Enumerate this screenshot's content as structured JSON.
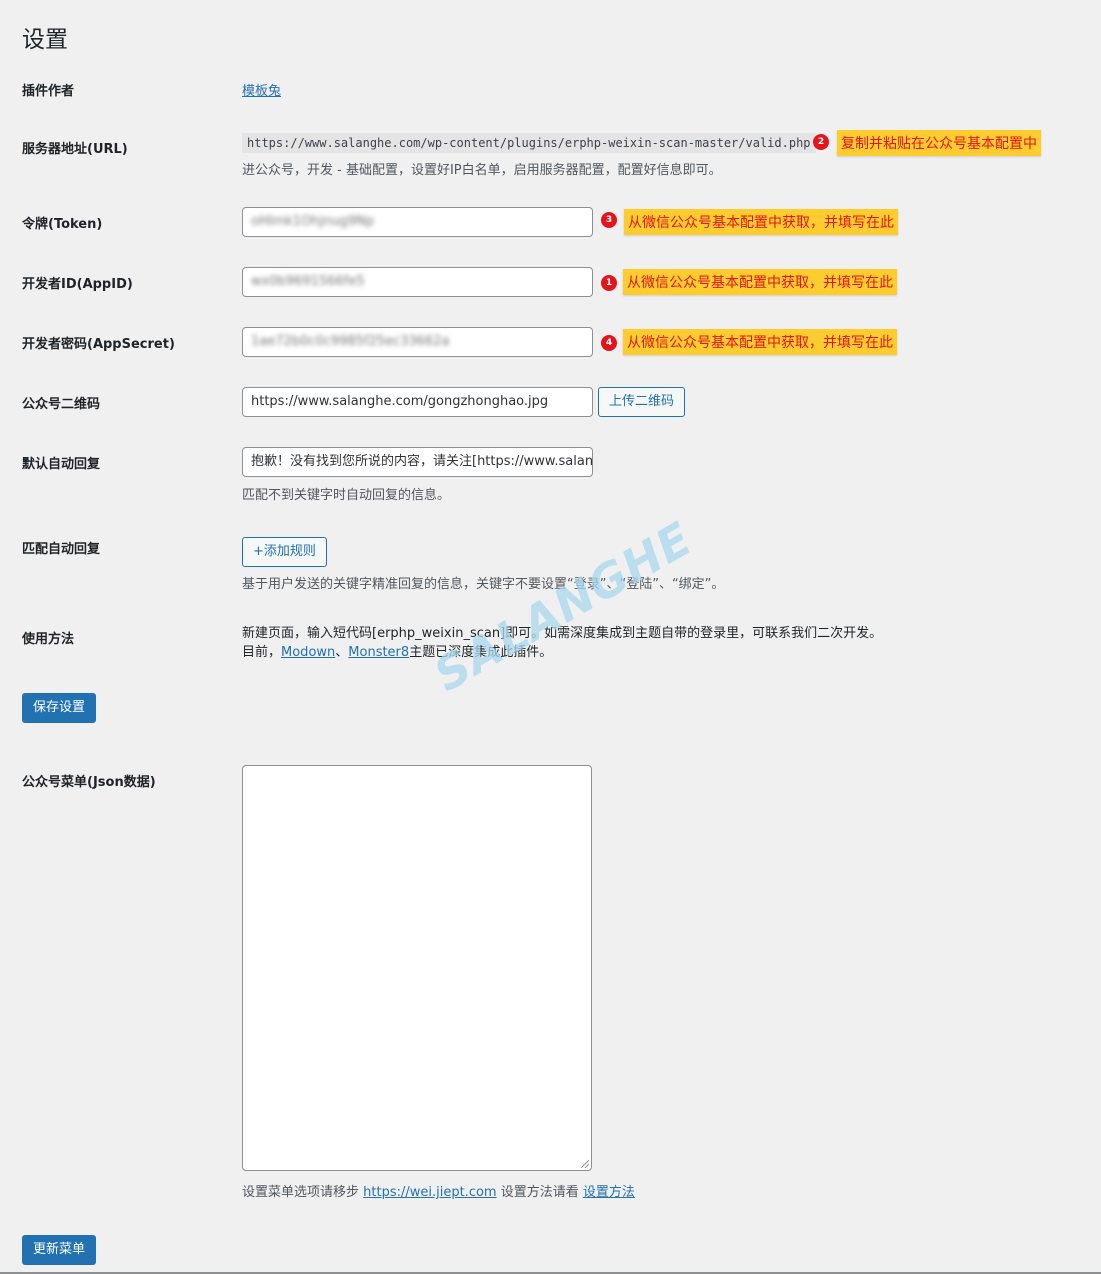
{
  "page": {
    "title": "设置"
  },
  "rows": {
    "author": {
      "label": "插件作者",
      "link": "模板兔"
    },
    "server_url": {
      "label": "服务器地址(URL)",
      "value": "https://www.salanghe.com/wp-content/plugins/erphp-weixin-scan-master/valid.php",
      "badge": "2",
      "note": "复制并粘贴在公众号基本配置中",
      "desc": "进公众号，开发 - 基础配置，设置好IP白名单，启用服务器配置，配置好信息即可。"
    },
    "token": {
      "label": "令牌(Token)",
      "value": "oHImk1Ohjnug9Np",
      "badge": "3",
      "note": "从微信公众号基本配置中获取，并填写在此"
    },
    "appid": {
      "label": "开发者ID(AppID)",
      "value": "wx0b9691566fe5",
      "badge": "1",
      "note": "从微信公众号基本配置中获取，并填写在此"
    },
    "appsecret": {
      "label": "开发者密码(AppSecret)",
      "value": "1ae72b0c0c9985f25ec33662a",
      "badge": "4",
      "note": "从微信公众号基本配置中获取，并填写在此"
    },
    "qrcode": {
      "label": "公众号二维码",
      "value": "https://www.salanghe.com/gongzhonghao.jpg",
      "button": "上传二维码"
    },
    "default_reply": {
      "label": "默认自动回复",
      "value": "抱歉！没有找到您所说的内容，请关注[https://www.salanghe.com]",
      "desc": "匹配不到关键字时自动回复的信息。"
    },
    "match_reply": {
      "label": "匹配自动回复",
      "button": "+添加规则",
      "desc": "基于用户发送的关键字精准回复的信息，关键字不要设置“登录”、“登陆”、“绑定”。"
    },
    "usage": {
      "label": "使用方法",
      "line1": "新建页面，输入短代码[erphp_weixin_scan]即可。如需深度集成到主题自带的登录里，可联系我们二次开发。",
      "line2_prefix": "目前，",
      "link1": "Modown",
      "sep": "、",
      "link2": "Monster8",
      "line2_suffix": "主题已深度集成此插件。"
    }
  },
  "save_button": "保存设置",
  "menu": {
    "label": "公众号菜单(Json数据)",
    "value": "",
    "help_prefix": "设置菜单选项请移步 ",
    "help_link": "https://wei.jiept.com",
    "help_middle": " 设置方法请看 ",
    "help_link2": "设置方法"
  },
  "update_button": "更新菜单",
  "watermark": "SALANGHE",
  "colors": {
    "background": "#f0f0f1",
    "accent": "#2271b1",
    "note_bg": "#fdcc2f",
    "note_text": "#e3141c",
    "badge": "#e3141c"
  }
}
